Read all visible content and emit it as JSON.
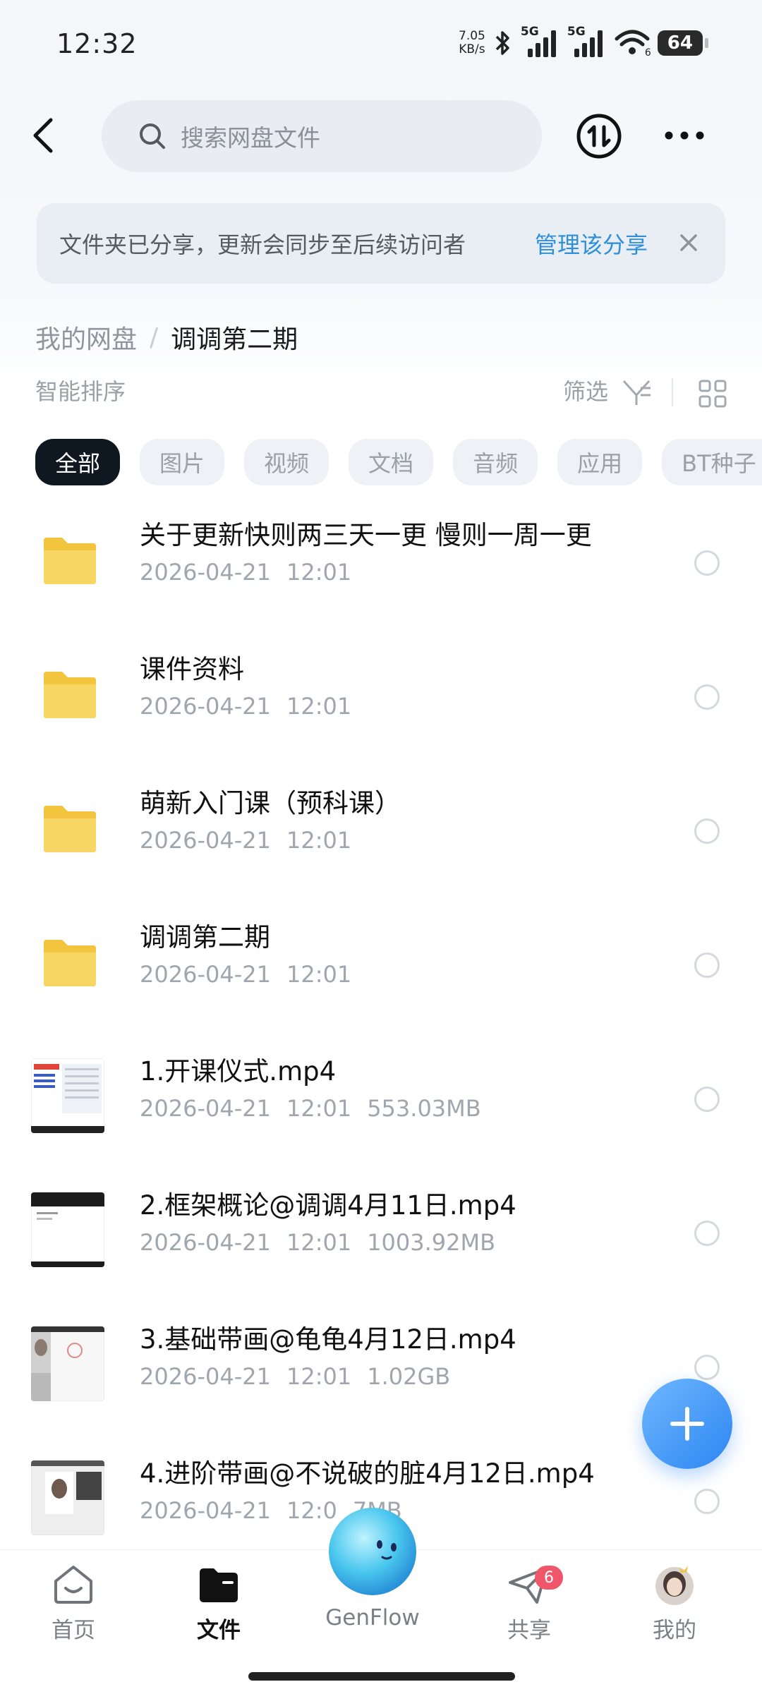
{
  "status_bar": {
    "time": "12:32",
    "speed_value": "7.05",
    "speed_unit": "KB/s",
    "network_1": "5G",
    "network_2": "5G",
    "wifi_badge": "6",
    "battery": "64"
  },
  "header": {
    "back_icon": "chevron-left-icon",
    "search_placeholder": "搜索网盘文件",
    "transfer_icon": "upload-download-icon",
    "more_icon": "more-dots-icon"
  },
  "share_banner": {
    "text": "文件夹已分享，更新会同步至后续访问者",
    "link": "管理该分享"
  },
  "breadcrumb": {
    "root": "我的网盘",
    "separator": "/",
    "current": "调调第二期"
  },
  "toolbar": {
    "sort_label": "智能排序",
    "filter_label": "筛选"
  },
  "chips": [
    "全部",
    "图片",
    "视频",
    "文档",
    "音频",
    "应用",
    "BT种子"
  ],
  "files": [
    {
      "name": "关于更新快则两三天一更 慢则一周一更",
      "date": "2026-04-21",
      "time": "12:01",
      "size": "",
      "kind": "folder"
    },
    {
      "name": "课件资料",
      "date": "2026-04-21",
      "time": "12:01",
      "size": "",
      "kind": "folder"
    },
    {
      "name": "萌新入门课（预科课）",
      "date": "2026-04-21",
      "time": "12:01",
      "size": "",
      "kind": "folder"
    },
    {
      "name": "调调第二期",
      "date": "2026-04-21",
      "time": "12:01",
      "size": "",
      "kind": "folder"
    },
    {
      "name": "1.开课仪式.mp4",
      "date": "2026-04-21",
      "time": "12:01",
      "size": "553.03MB",
      "kind": "video"
    },
    {
      "name": "2.框架概论@调调4月11日.mp4",
      "date": "2026-04-21",
      "time": "12:01",
      "size": "1003.92MB",
      "kind": "video"
    },
    {
      "name": "3.基础带画@龟龟4月12日.mp4",
      "date": "2026-04-21",
      "time": "12:01",
      "size": "1.02GB",
      "kind": "video"
    },
    {
      "name": "4.进阶带画@不说破的脏4月12日.mp4",
      "date": "2026-04-21",
      "time": "12:0",
      "size": "7MB",
      "kind": "video"
    }
  ],
  "fab_icon": "plus-icon",
  "nav": {
    "items": [
      {
        "label": "首页",
        "icon": "home-icon"
      },
      {
        "label": "文件",
        "icon": "folder-icon"
      },
      {
        "label": "GenFlow",
        "icon": "genflow-mascot-icon"
      },
      {
        "label": "共享",
        "icon": "send-icon",
        "badge": "6"
      },
      {
        "label": "我的",
        "icon": "avatar"
      }
    ]
  },
  "colors": {
    "accent_link": "#2f8fd8",
    "chip_active": "#0f1720",
    "fab": "#2d86f2",
    "badge": "#f0566a",
    "folder": "#f7cf4c"
  }
}
